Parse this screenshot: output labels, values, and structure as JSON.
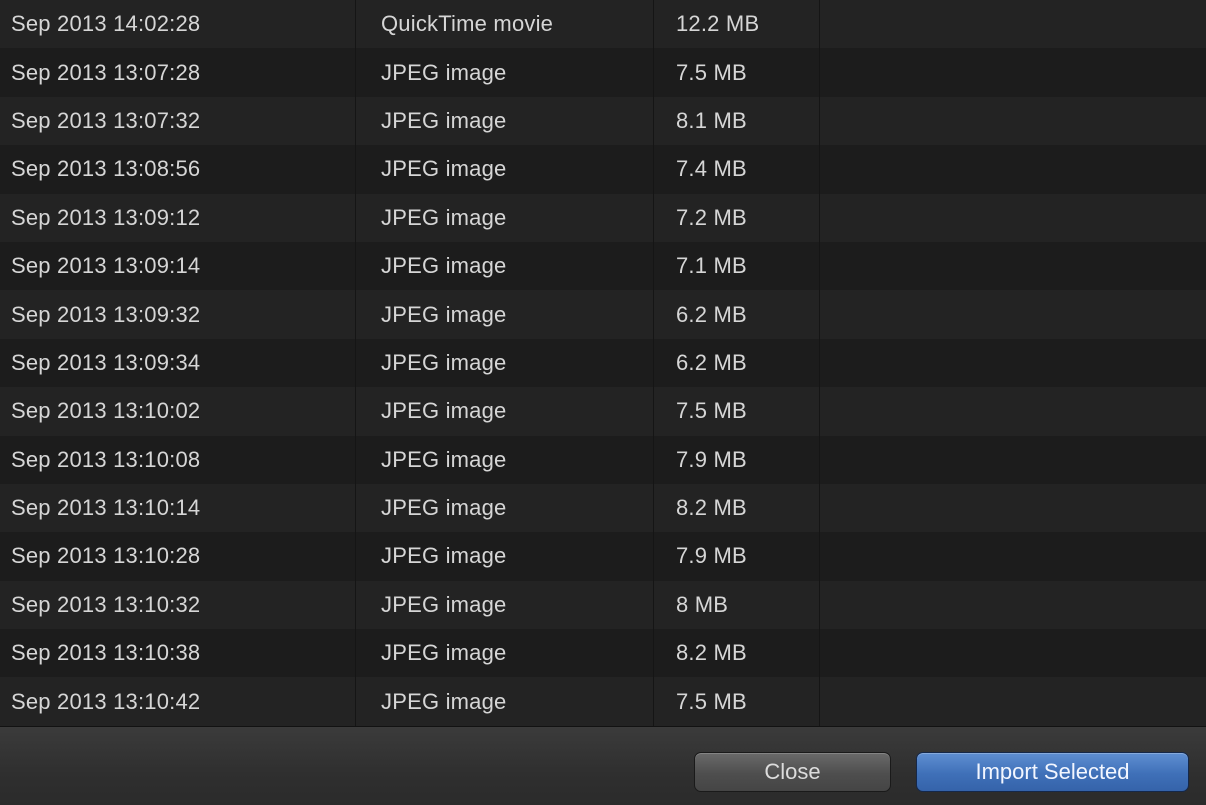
{
  "files": [
    {
      "date": "Sep 2013 14:02:28",
      "kind": "QuickTime movie",
      "size": "12.2 MB"
    },
    {
      "date": "Sep 2013 13:07:28",
      "kind": "JPEG image",
      "size": "7.5 MB"
    },
    {
      "date": "Sep 2013 13:07:32",
      "kind": "JPEG image",
      "size": "8.1 MB"
    },
    {
      "date": "Sep 2013 13:08:56",
      "kind": "JPEG image",
      "size": "7.4 MB"
    },
    {
      "date": "Sep 2013 13:09:12",
      "kind": "JPEG image",
      "size": "7.2 MB"
    },
    {
      "date": "Sep 2013 13:09:14",
      "kind": "JPEG image",
      "size": "7.1 MB"
    },
    {
      "date": "Sep 2013 13:09:32",
      "kind": "JPEG image",
      "size": "6.2 MB"
    },
    {
      "date": "Sep 2013 13:09:34",
      "kind": "JPEG image",
      "size": "6.2 MB"
    },
    {
      "date": "Sep 2013 13:10:02",
      "kind": "JPEG image",
      "size": "7.5 MB"
    },
    {
      "date": "Sep 2013 13:10:08",
      "kind": "JPEG image",
      "size": "7.9 MB"
    },
    {
      "date": "Sep 2013 13:10:14",
      "kind": "JPEG image",
      "size": "8.2 MB"
    },
    {
      "date": "Sep 2013 13:10:28",
      "kind": "JPEG image",
      "size": "7.9 MB"
    },
    {
      "date": "Sep 2013 13:10:32",
      "kind": "JPEG image",
      "size": "8 MB"
    },
    {
      "date": "Sep 2013 13:10:38",
      "kind": "JPEG image",
      "size": "8.2 MB"
    },
    {
      "date": "Sep 2013 13:10:42",
      "kind": "JPEG image",
      "size": "7.5 MB"
    }
  ],
  "footer": {
    "close_label": "Close",
    "import_label": "Import Selected"
  },
  "colors": {
    "background": "#1f1f1f",
    "row_odd": "#232323",
    "row_even": "#1c1c1c",
    "text": "#d6d6d6",
    "import_button": "#3f70b8"
  }
}
